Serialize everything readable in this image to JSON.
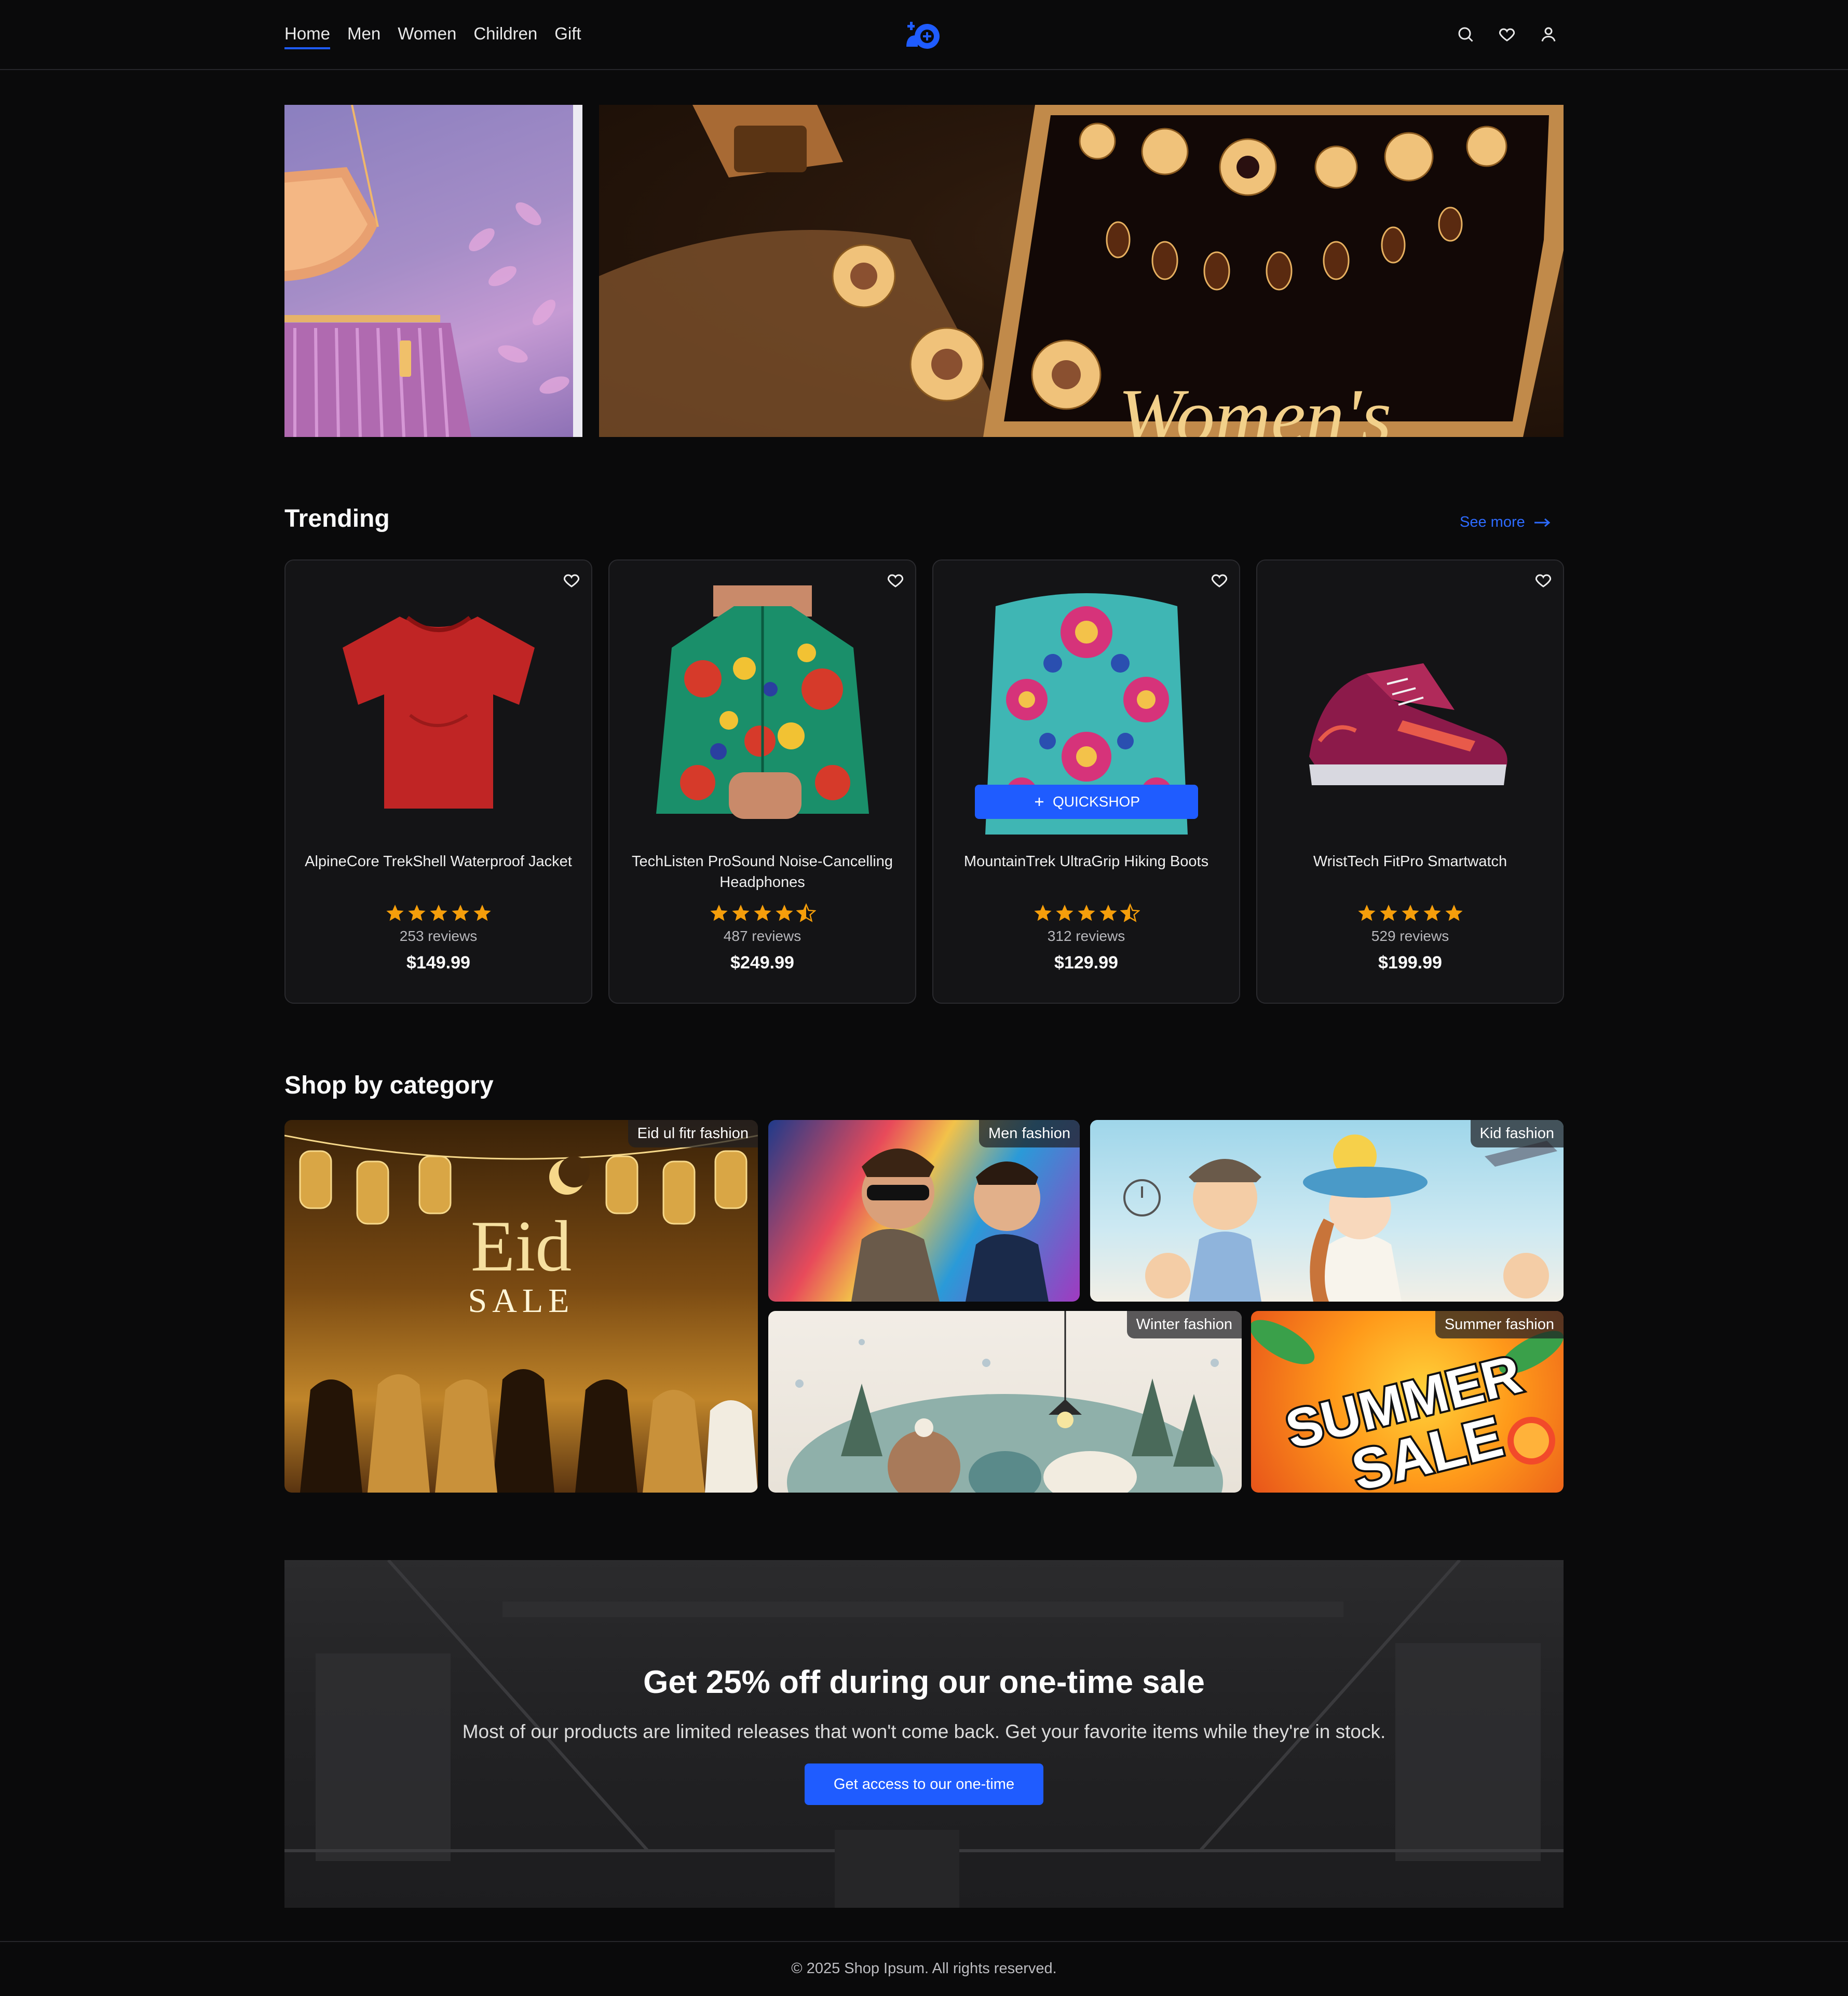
{
  "nav": {
    "items": [
      {
        "label": "Home",
        "active": true
      },
      {
        "label": "Men",
        "active": false
      },
      {
        "label": "Women",
        "active": false
      },
      {
        "label": "Children",
        "active": false
      },
      {
        "label": "Gift",
        "active": false
      }
    ]
  },
  "header": {
    "logo_icon": "brand-logo-icon",
    "icons": [
      "search-icon",
      "heart-icon",
      "user-icon"
    ]
  },
  "hero": {
    "banner_text": "Women's"
  },
  "trending": {
    "title": "Trending",
    "see_more": "See more",
    "quickshop": "QUICKSHOP",
    "products": [
      {
        "name": "AlpineCore TrekShell Waterproof Jacket",
        "rating": 5,
        "reviews": "253 reviews",
        "price": "$149.99"
      },
      {
        "name": "TechListen ProSound Noise-Cancelling Headphones",
        "rating": 4.5,
        "reviews": "487 reviews",
        "price": "$249.99"
      },
      {
        "name": "MountainTrek UltraGrip Hiking Boots",
        "rating": 4.5,
        "reviews": "312 reviews",
        "price": "$129.99"
      },
      {
        "name": "WristTech FitPro Smartwatch",
        "rating": 5,
        "reviews": "529 reviews",
        "price": "$199.99"
      }
    ]
  },
  "category": {
    "title": "Shop by category",
    "tiles": [
      {
        "label": "Eid ul fitr fashion",
        "art_title": "Eid",
        "art_sub": "SALE"
      },
      {
        "label": "Men fashion"
      },
      {
        "label": "Kid fashion"
      },
      {
        "label": "Winter fashion"
      },
      {
        "label": "Summer fashion",
        "art_title": "SUMMER",
        "art_sub": "SALE"
      }
    ]
  },
  "promo": {
    "title": "Get 25% off during our one-time sale",
    "text": "Most of our products are limited releases that won't come back. Get your favorite items while they're in stock.",
    "cta": "Get access to our one-time"
  },
  "footer": {
    "text": "© 2025 Shop Ipsum. All rights reserved."
  },
  "colors": {
    "accent": "#1f5cff",
    "star": "#f59e0b",
    "background": "#0a0a0b",
    "card": "#141416"
  }
}
